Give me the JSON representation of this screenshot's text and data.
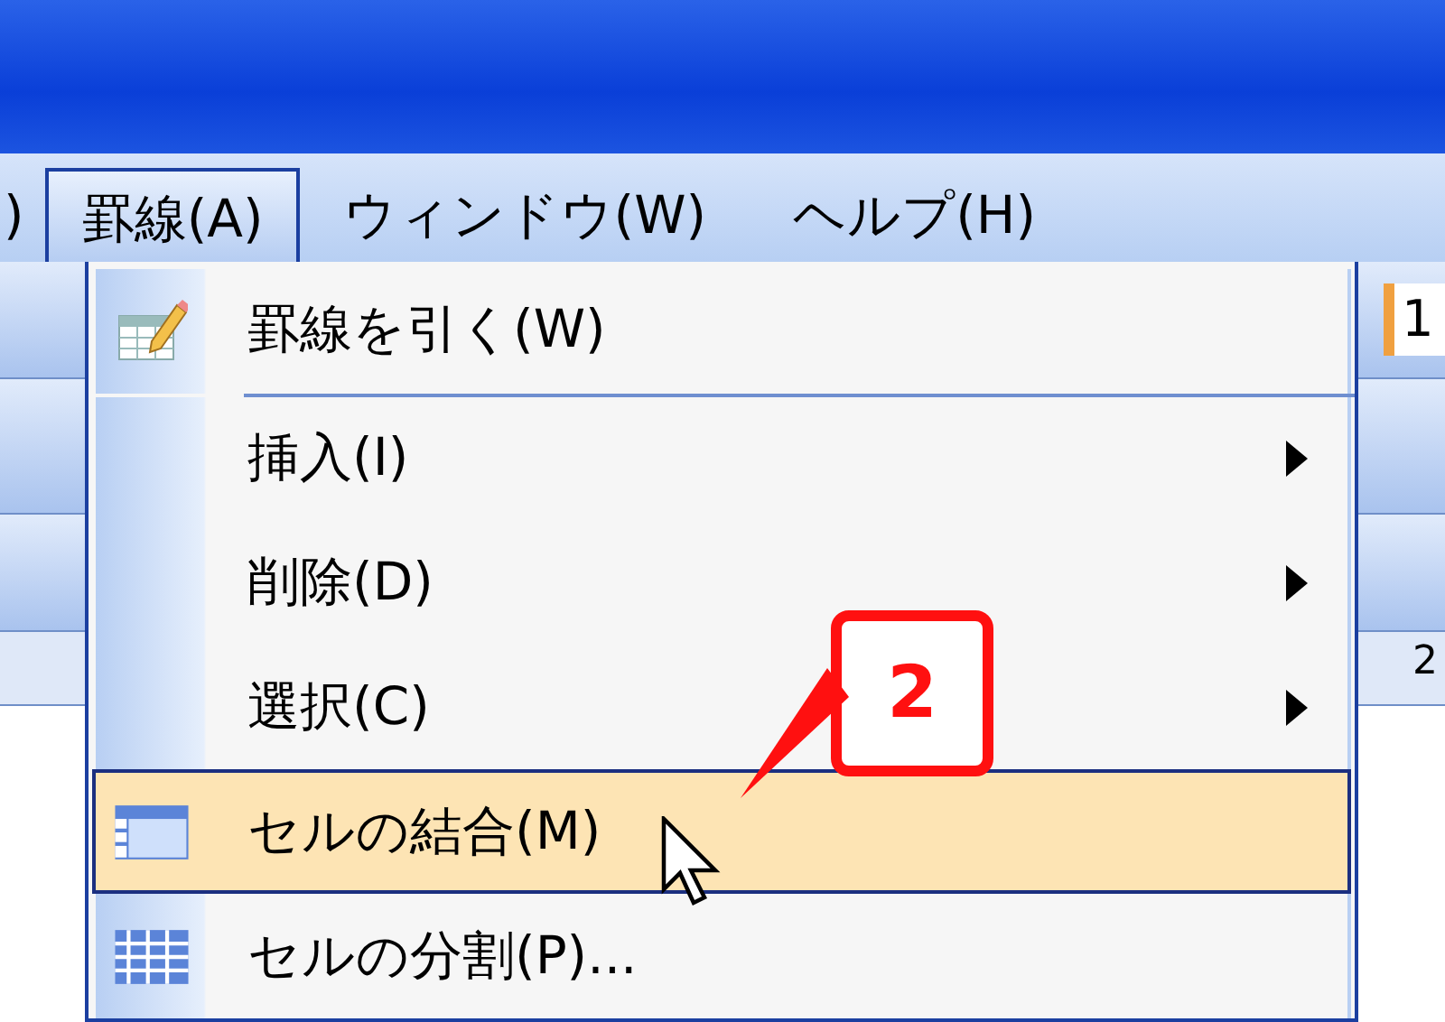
{
  "menubar": {
    "items": [
      {
        "label": ")",
        "selected": false
      },
      {
        "label": "罫線(A)",
        "selected": true
      },
      {
        "label": "ウィンドウ(W)",
        "selected": false
      },
      {
        "label": "ヘルプ(H)",
        "selected": false
      }
    ]
  },
  "menu": {
    "items": [
      {
        "kind": "draw",
        "label": "罫線を引く(W)",
        "highlighted": false
      },
      {
        "kind": "separator"
      },
      {
        "kind": "submenu",
        "label": "挿入(I)",
        "highlighted": false
      },
      {
        "kind": "submenu",
        "label": "削除(D)",
        "highlighted": false
      },
      {
        "kind": "submenu",
        "label": "選択(C)",
        "highlighted": false
      },
      {
        "kind": "merge",
        "label": "セルの結合(M)",
        "highlighted": true
      },
      {
        "kind": "split",
        "label": "セルの分割(P)...",
        "highlighted": false
      }
    ]
  },
  "callout": {
    "label": "2"
  },
  "side_texts": [
    "1",
    "2"
  ]
}
